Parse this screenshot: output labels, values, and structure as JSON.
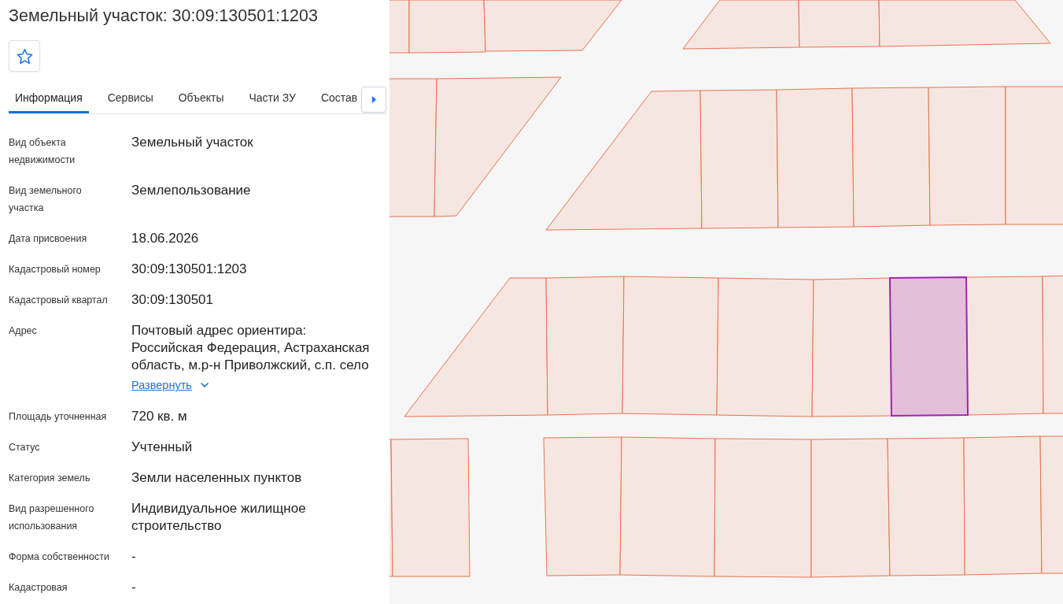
{
  "title": "Земельный участок: 30:09:130501:1203",
  "favorite": {
    "on": false
  },
  "tabs": [
    {
      "label": "Информация",
      "selected": true
    },
    {
      "label": "Сервисы",
      "selected": false
    },
    {
      "label": "Объекты",
      "selected": false
    },
    {
      "label": "Части ЗУ",
      "selected": false
    },
    {
      "label": "Состав",
      "selected": false
    }
  ],
  "properties": [
    {
      "kind": "text",
      "label": "Вид объекта недвижимости",
      "value": "Земельный участок"
    },
    {
      "kind": "text",
      "label": "Вид земельного участка",
      "value": "Землепользование"
    },
    {
      "kind": "text",
      "label": "Дата присвоения",
      "value": "18.06.2026"
    },
    {
      "kind": "text",
      "label": "Кадастровый номер",
      "value": "30:09:130501:1203"
    },
    {
      "kind": "text",
      "label": "Кадастровый квартал",
      "value": "30:09:130501"
    },
    {
      "kind": "expandable",
      "label": "Адрес",
      "value": "Почтовый адрес ориентира: Российская Федерация, Астраханская область, м.р-н Приволжский, с.п. село",
      "expand_link": "Развернуть"
    },
    {
      "kind": "text",
      "label": "Площадь уточненная",
      "value": "720 кв. м"
    },
    {
      "kind": "text",
      "label": "Статус",
      "value": "Учтенный"
    },
    {
      "kind": "text",
      "label": "Категория земель",
      "value": "Земли населенных пунктов"
    },
    {
      "kind": "text",
      "label": "Вид разрешенного использования",
      "value": "Индивидуальное жилищное строительство"
    },
    {
      "kind": "text",
      "label": "Форма собственности",
      "value": "-"
    },
    {
      "kind": "text",
      "label": "Кадастровая",
      "value": "-"
    }
  ]
}
